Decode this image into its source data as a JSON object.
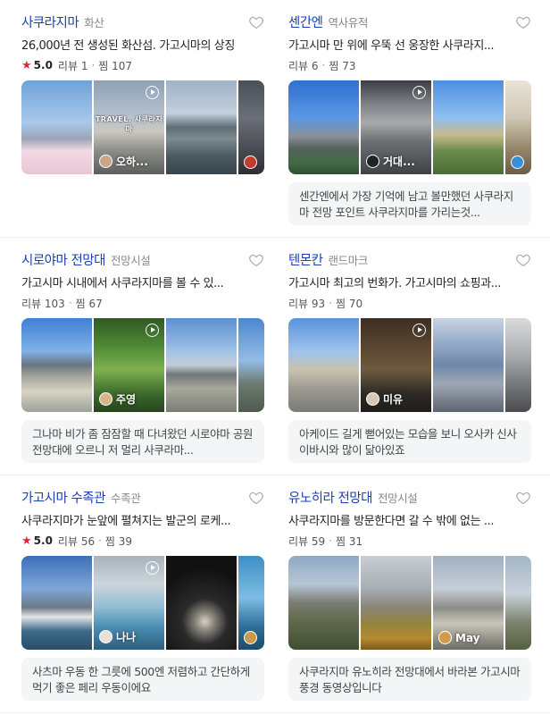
{
  "cards": [
    {
      "name": "사쿠라지마",
      "category": "화산",
      "desc": "26,000년 전 생성된 화산섬. 가고시마의 상징",
      "rating": "5.0",
      "reviews_label": "리뷰 1",
      "saves_label": "찜 107",
      "photos": [
        {
          "author": "",
          "overlay": ""
        },
        {
          "author": "오하...",
          "overlay": "TRAVEL. 사쿠라지마"
        },
        {
          "author": "",
          "overlay": ""
        },
        {
          "author": "",
          "overlay": ""
        }
      ],
      "review": ""
    },
    {
      "name": "센간엔",
      "category": "역사유적",
      "desc": "가고시마 만 위에 우뚝 선 웅장한 사쿠라지...",
      "rating": "",
      "reviews_label": "리뷰 6",
      "saves_label": "찜 73",
      "photos": [
        {
          "author": "",
          "overlay": ""
        },
        {
          "author": "거대...",
          "overlay": ""
        },
        {
          "author": "",
          "overlay": ""
        },
        {
          "author": "",
          "overlay": ""
        }
      ],
      "review": "센간엔에서 가장 기억에 남고 볼만했던 사쿠라지마 전망 포인트 사쿠라지마를 가리는것..."
    },
    {
      "name": "시로야마 전망대",
      "category": "전망시설",
      "desc": "가고시마 시내에서 사쿠라지마를 볼 수 있...",
      "rating": "",
      "reviews_label": "리뷰 103",
      "saves_label": "찜 67",
      "photos": [
        {
          "author": "",
          "overlay": ""
        },
        {
          "author": "주영",
          "overlay": ""
        },
        {
          "author": "",
          "overlay": ""
        },
        {
          "author": "",
          "overlay": ""
        }
      ],
      "review": "그나마 비가 좀 잠잠할 때 다녀왔던 시로야마 공원 전망대에 오르니 저 멀리 사쿠라마..."
    },
    {
      "name": "텐몬칸",
      "category": "랜드마크",
      "desc": "가고시마 최고의 번화가. 가고시마의 쇼핑과...",
      "rating": "",
      "reviews_label": "리뷰 93",
      "saves_label": "찜 70",
      "photos": [
        {
          "author": "",
          "overlay": ""
        },
        {
          "author": "미유",
          "overlay": ""
        },
        {
          "author": "",
          "overlay": ""
        },
        {
          "author": "",
          "overlay": ""
        }
      ],
      "review": "아케이드 길게 뻗어있는 모습을 보니 오사카 신사이바시와 많이 닮아있죠"
    },
    {
      "name": "가고시마 수족관",
      "category": "수족관",
      "desc": "사쿠라지마가 눈앞에 펼쳐지는 발군의 로케...",
      "rating": "5.0",
      "reviews_label": "리뷰 56",
      "saves_label": "찜 39",
      "photos": [
        {
          "author": "",
          "overlay": ""
        },
        {
          "author": "나나",
          "overlay": ""
        },
        {
          "author": "",
          "overlay": ""
        },
        {
          "author": "",
          "overlay": ""
        }
      ],
      "review": "사츠마 우동 한 그릇에 500엔 저렴하고 간단하게 먹기 좋은 페리 우동이에요"
    },
    {
      "name": "유노히라 전망대",
      "category": "전망시설",
      "desc": "사쿠라지마를 방문한다면 갈 수 밖에 없는 ...",
      "rating": "",
      "reviews_label": "리뷰 59",
      "saves_label": "찜 31",
      "photos": [
        {
          "author": "",
          "overlay": ""
        },
        {
          "author": "",
          "overlay": ""
        },
        {
          "author": "May",
          "overlay": ""
        }
      ],
      "review": "사쿠라지마 유노히라 전망대에서 바라본 가고시마 풍경 동영상입니다"
    }
  ],
  "colors": {
    "name": "#1a3fb8",
    "star": "#e0243a",
    "review_bg": "#f4f5f7"
  },
  "icons": {
    "heart": "heart-outline-icon",
    "star": "star-icon",
    "play": "play-icon"
  }
}
